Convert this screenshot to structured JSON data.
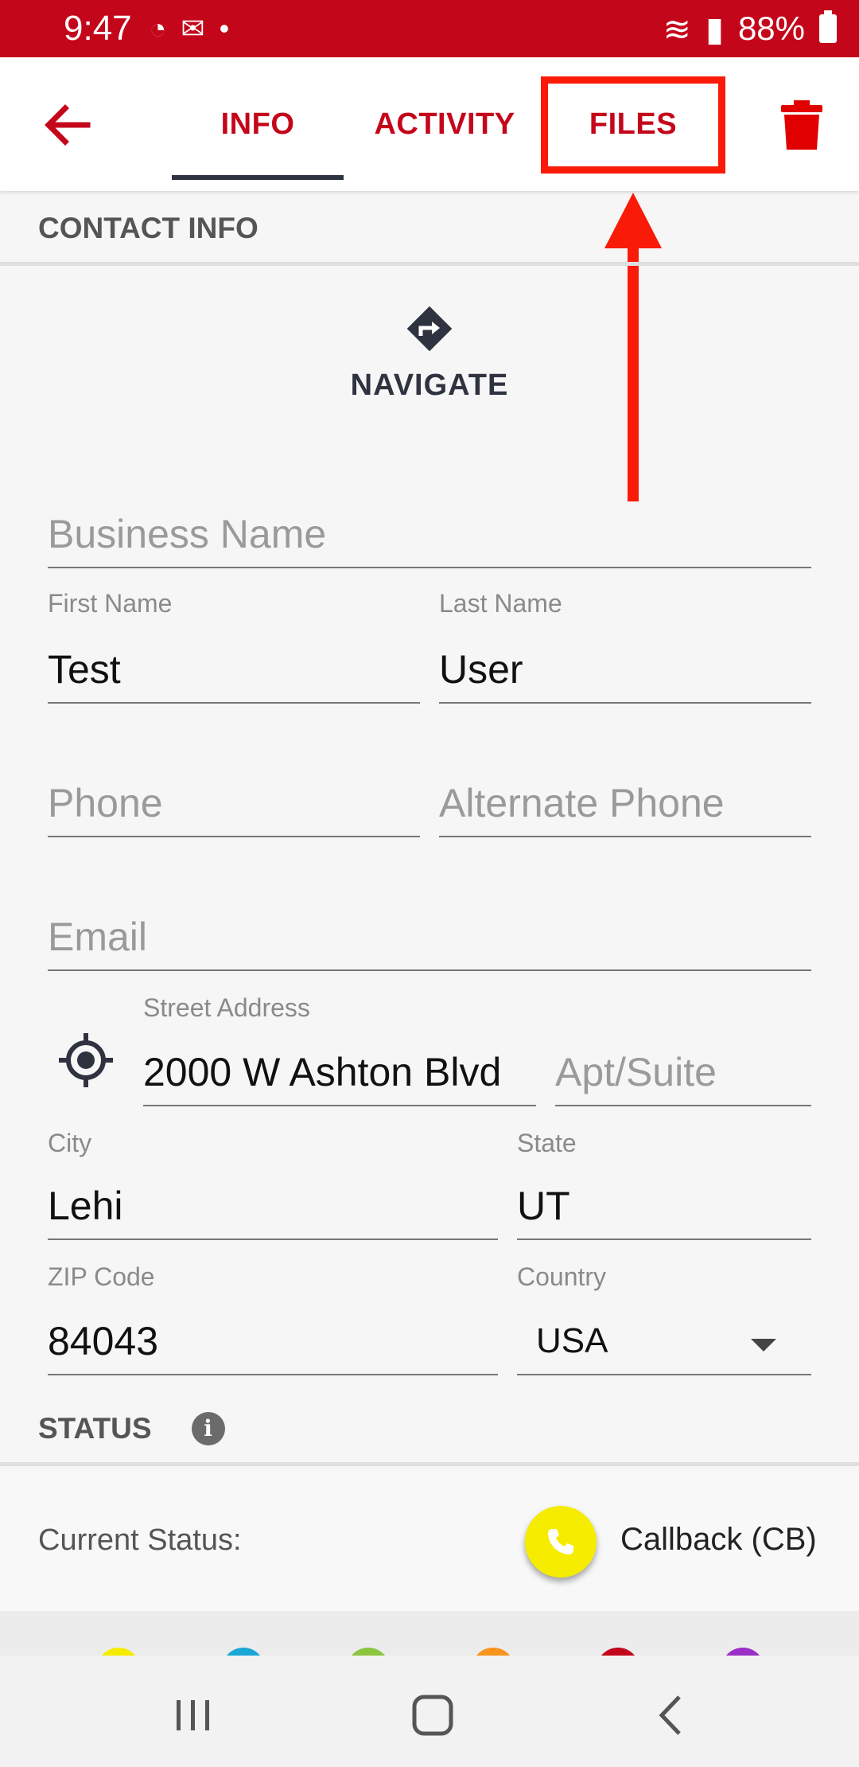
{
  "status_bar": {
    "time": "9:47",
    "battery": "88%"
  },
  "header": {
    "tabs": [
      {
        "label": "INFO",
        "active": true
      },
      {
        "label": "ACTIVITY",
        "active": false
      },
      {
        "label": "FILES",
        "active": false
      }
    ]
  },
  "contact_info": {
    "title": "CONTACT INFO",
    "navigate_label": "NAVIGATE",
    "fields": {
      "business_name": {
        "placeholder": "Business Name",
        "value": ""
      },
      "first_name": {
        "label": "First Name",
        "value": "Test"
      },
      "last_name": {
        "label": "Last Name",
        "value": "User"
      },
      "phone": {
        "placeholder": "Phone",
        "value": ""
      },
      "alternate_phone": {
        "placeholder": "Alternate Phone",
        "value": ""
      },
      "email": {
        "placeholder": "Email",
        "value": ""
      },
      "street_address": {
        "label": "Street Address",
        "value": "2000 W Ashton Blvd"
      },
      "apt_suite": {
        "placeholder": "Apt/Suite",
        "value": ""
      },
      "city": {
        "label": "City",
        "value": "Lehi"
      },
      "state": {
        "label": "State",
        "value": "UT"
      },
      "zip": {
        "label": "ZIP Code",
        "value": "84043"
      },
      "country": {
        "label": "Country",
        "value": "USA"
      }
    }
  },
  "status_section": {
    "title": "STATUS",
    "current_status_label": "Current Status:",
    "current_status_value": "Callback (CB)"
  },
  "colors": {
    "brand_red": "#c4061b",
    "annotation_red": "#fa1a08",
    "status_yellow": "#f5ec00",
    "dots": [
      "#f5ec00",
      "#1aa7d6",
      "#8cc63f",
      "#f7941d",
      "#c4061b",
      "#9b30c8"
    ]
  },
  "icons": {
    "back": "arrow-left-icon",
    "delete": "trash-icon",
    "navigate": "directions-icon",
    "location": "my-location-icon",
    "info": "info-icon",
    "phone": "phone-icon"
  }
}
